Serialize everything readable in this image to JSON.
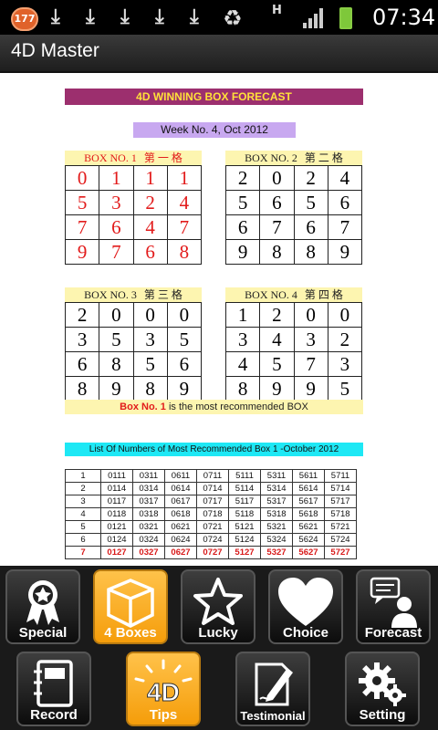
{
  "status_bar": {
    "notification_count": "177",
    "time": "07:34",
    "data_indicator": "H"
  },
  "app": {
    "title": "4D Master"
  },
  "forecast": {
    "banner": "4D WINNING BOX FORECAST",
    "week": "Week No. 4, Oct 2012",
    "boxes": [
      {
        "label": "BOX NO. 1",
        "label_cn": "第 一 格",
        "rows": [
          [
            "0",
            "1",
            "1",
            "1"
          ],
          [
            "5",
            "3",
            "2",
            "4"
          ],
          [
            "7",
            "6",
            "4",
            "7"
          ],
          [
            "9",
            "7",
            "6",
            "8"
          ]
        ]
      },
      {
        "label": "BOX NO. 2",
        "label_cn": "第 二 格",
        "rows": [
          [
            "2",
            "0",
            "2",
            "4"
          ],
          [
            "5",
            "6",
            "5",
            "6"
          ],
          [
            "6",
            "7",
            "6",
            "7"
          ],
          [
            "9",
            "8",
            "8",
            "9"
          ]
        ]
      },
      {
        "label": "BOX NO. 3",
        "label_cn": "第 三 格",
        "rows": [
          [
            "2",
            "0",
            "0",
            "0"
          ],
          [
            "3",
            "5",
            "3",
            "5"
          ],
          [
            "6",
            "8",
            "5",
            "6"
          ],
          [
            "8",
            "9",
            "8",
            "9"
          ]
        ]
      },
      {
        "label": "BOX NO. 4",
        "label_cn": "第 四 格",
        "rows": [
          [
            "1",
            "2",
            "0",
            "0"
          ],
          [
            "3",
            "4",
            "3",
            "2"
          ],
          [
            "4",
            "5",
            "7",
            "3"
          ],
          [
            "8",
            "9",
            "9",
            "5"
          ]
        ]
      }
    ],
    "recommend_box": "Box No. 1",
    "recommend_text": "is the most recommended BOX",
    "list_title": "List Of Numbers of Most Recommended Box 1 -October 2012",
    "list_rows": [
      [
        "1",
        "0111",
        "0311",
        "0611",
        "0711",
        "5111",
        "5311",
        "5611",
        "5711"
      ],
      [
        "2",
        "0114",
        "0314",
        "0614",
        "0714",
        "5114",
        "5314",
        "5614",
        "5714"
      ],
      [
        "3",
        "0117",
        "0317",
        "0617",
        "0717",
        "5117",
        "5317",
        "5617",
        "5717"
      ],
      [
        "4",
        "0118",
        "0318",
        "0618",
        "0718",
        "5118",
        "5318",
        "5618",
        "5718"
      ],
      [
        "5",
        "0121",
        "0321",
        "0621",
        "0721",
        "5121",
        "5321",
        "5621",
        "5721"
      ],
      [
        "6",
        "0124",
        "0324",
        "0624",
        "0724",
        "5124",
        "5324",
        "5624",
        "5724"
      ],
      [
        "7",
        "0127",
        "0327",
        "0627",
        "0727",
        "5127",
        "5327",
        "5627",
        "5727"
      ]
    ]
  },
  "nav": {
    "row1": [
      {
        "label": "Special",
        "icon": "award-ribbon-icon"
      },
      {
        "label": "4 Boxes",
        "icon": "box-icon",
        "selected": true
      },
      {
        "label": "Lucky",
        "icon": "star-icon"
      },
      {
        "label": "Choice",
        "icon": "heart-icon"
      },
      {
        "label": "Forecast",
        "icon": "person-speech-icon"
      }
    ],
    "row2": [
      {
        "label": "Record",
        "icon": "notebook-icon"
      },
      {
        "label": "Tips",
        "icon": "4d-tips-icon",
        "badge": "4D",
        "selected": true
      },
      {
        "label": "Testimonial",
        "icon": "pen-paper-icon"
      },
      {
        "label": "Setting",
        "icon": "gear-icon"
      }
    ]
  },
  "colors": {
    "banner_bg": "#9c2f6e",
    "banner_text": "#ffe13a",
    "week_bg": "#c8a8f0",
    "box_header_bg": "#fdf5b0",
    "list_header_bg": "#1ee8f5",
    "highlight_red": "#e21b1b",
    "selected_tile": "#f5a623"
  }
}
